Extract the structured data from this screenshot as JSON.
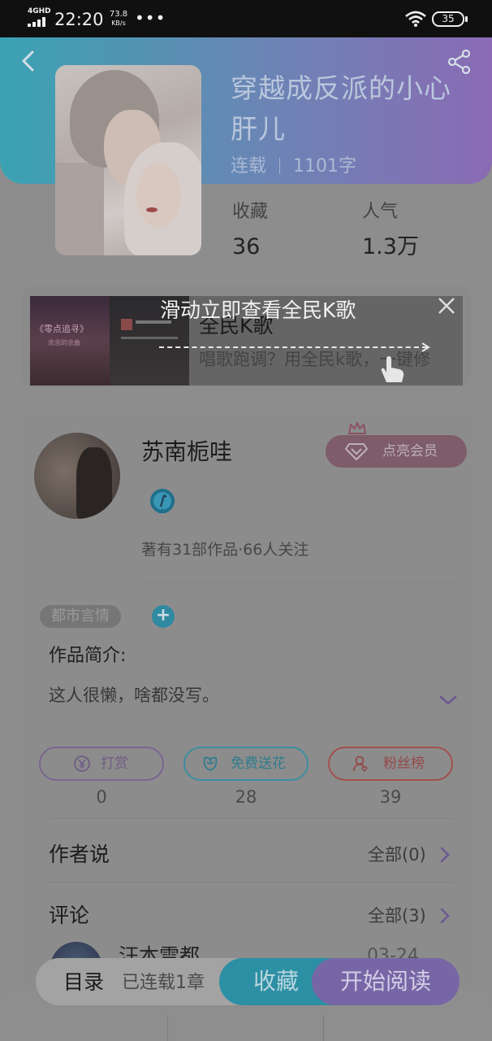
{
  "status_bar": {
    "network": "4GHD",
    "time": "22:20",
    "speed_value": "73.8",
    "speed_unit": "KB/s",
    "more": "•••",
    "battery": "35"
  },
  "book": {
    "title": "穿越成反派的小心肝儿",
    "status": "连载",
    "word_count": "1101字",
    "stats": [
      {
        "label": "收藏",
        "value": "36"
      },
      {
        "label": "人气",
        "value": "1.3万"
      }
    ]
  },
  "ad": {
    "hint": "滑动立即查看全民K歌",
    "title": "全民K歌",
    "description": "唱歌跑调？用全民k歌，一键修",
    "thumb_text": "《零点追寻》",
    "thumb_sub": "念念的念曲"
  },
  "author": {
    "name": "苏南栀哇",
    "vip_label": "点亮会员",
    "stats": "著有31部作品·66人关注"
  },
  "work": {
    "genre_tag": "都市言情",
    "add_tag": "+",
    "intro_label": "作品简介:",
    "intro_text": "这人很懒，啥都没写。"
  },
  "actions": [
    {
      "label": "打赏",
      "count": "0"
    },
    {
      "label": "免费送花",
      "count": "28"
    },
    {
      "label": "粉丝榜",
      "count": "39"
    }
  ],
  "author_says": {
    "title": "作者说",
    "link": "全部(0)"
  },
  "comments": {
    "title": "评论",
    "link": "全部(3)",
    "first_name": "汪本雪都",
    "first_date": "03-24"
  },
  "bottom_bar": {
    "toc": "目录",
    "serial_info": "已连载1章",
    "collect": "收藏",
    "read": "开始阅读"
  },
  "colors": {
    "header_start": "#3aa3b3",
    "header_end": "#8a6bb4",
    "teal": "#2d8fa3",
    "purple": "#7766a6",
    "overlay": "#8d8d8d"
  },
  "icons": [
    "back-icon",
    "share-icon",
    "close-icon",
    "hand-icon",
    "crown-icon",
    "diamond-icon",
    "level-badge-icon",
    "yen-icon",
    "flower-icon",
    "fans-icon",
    "chevron-down-icon",
    "chevron-right-icon"
  ]
}
